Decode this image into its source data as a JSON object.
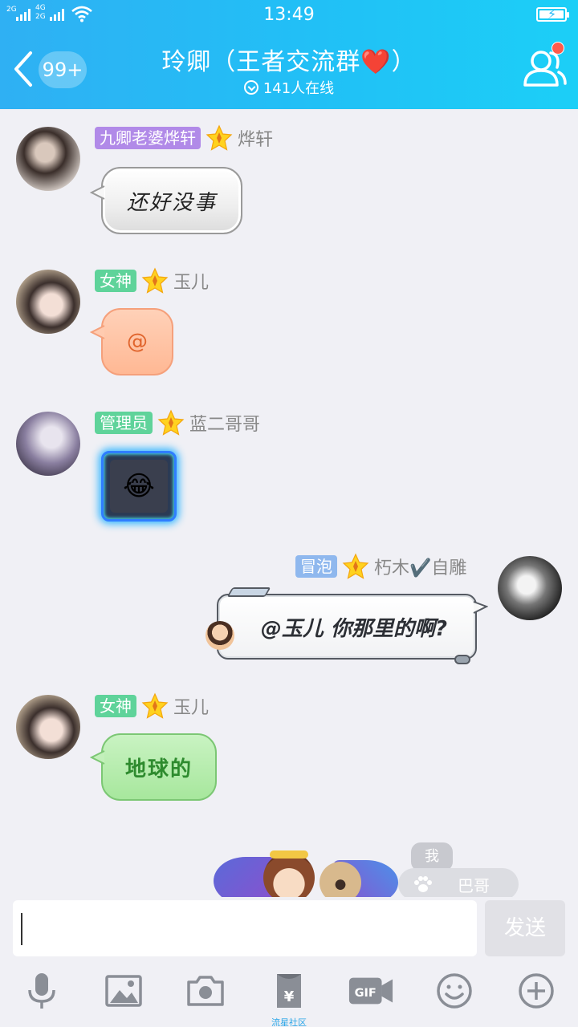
{
  "status_bar": {
    "signal1": "2G",
    "signal2_top": "4G",
    "signal2_bottom": "2G",
    "time": "13:49"
  },
  "header": {
    "unread_badge": "99+",
    "title": "玲卿（王者交流群❤️）",
    "online_count": "141人在线"
  },
  "messages": [
    {
      "side": "left",
      "tag": "九卿老婆烨轩",
      "tag_color": "#b18ae8",
      "nickname": "烨轩",
      "text": "还好没事",
      "bubble_style": "silver"
    },
    {
      "side": "left",
      "tag": "女神",
      "tag_color": "#5fd39a",
      "nickname": "玉儿",
      "text": "@",
      "bubble_style": "peach"
    },
    {
      "side": "left",
      "tag": "管理员",
      "tag_color": "#5fd39a",
      "nickname": "蓝二哥哥",
      "text": "😂",
      "bubble_style": "neon"
    },
    {
      "side": "right",
      "tag": "冒泡",
      "tag_color": "#8fb8ee",
      "nickname": "朽木✔️自雕",
      "text": "@玉儿 你那里的啊?",
      "bubble_style": "mech"
    },
    {
      "side": "left",
      "tag": "女神",
      "tag_color": "#5fd39a",
      "nickname": "玉儿",
      "text": "地球的",
      "bubble_style": "green"
    }
  ],
  "pet_area": {
    "me_label": "我",
    "pet_name": "巴哥"
  },
  "input": {
    "value": "",
    "send_label": "发送"
  },
  "toolbar": {
    "items": [
      "voice",
      "image",
      "camera",
      "red-packet",
      "gif",
      "emoji",
      "more"
    ],
    "redpacket_label": "流星社区",
    "gif_label": "GIF"
  },
  "colors": {
    "header_start": "#2fb0f3",
    "header_end": "#1ccff7",
    "background": "#f0f0f5",
    "icon_gray": "#8a8e96",
    "link_blue": "#2aa6e8"
  }
}
